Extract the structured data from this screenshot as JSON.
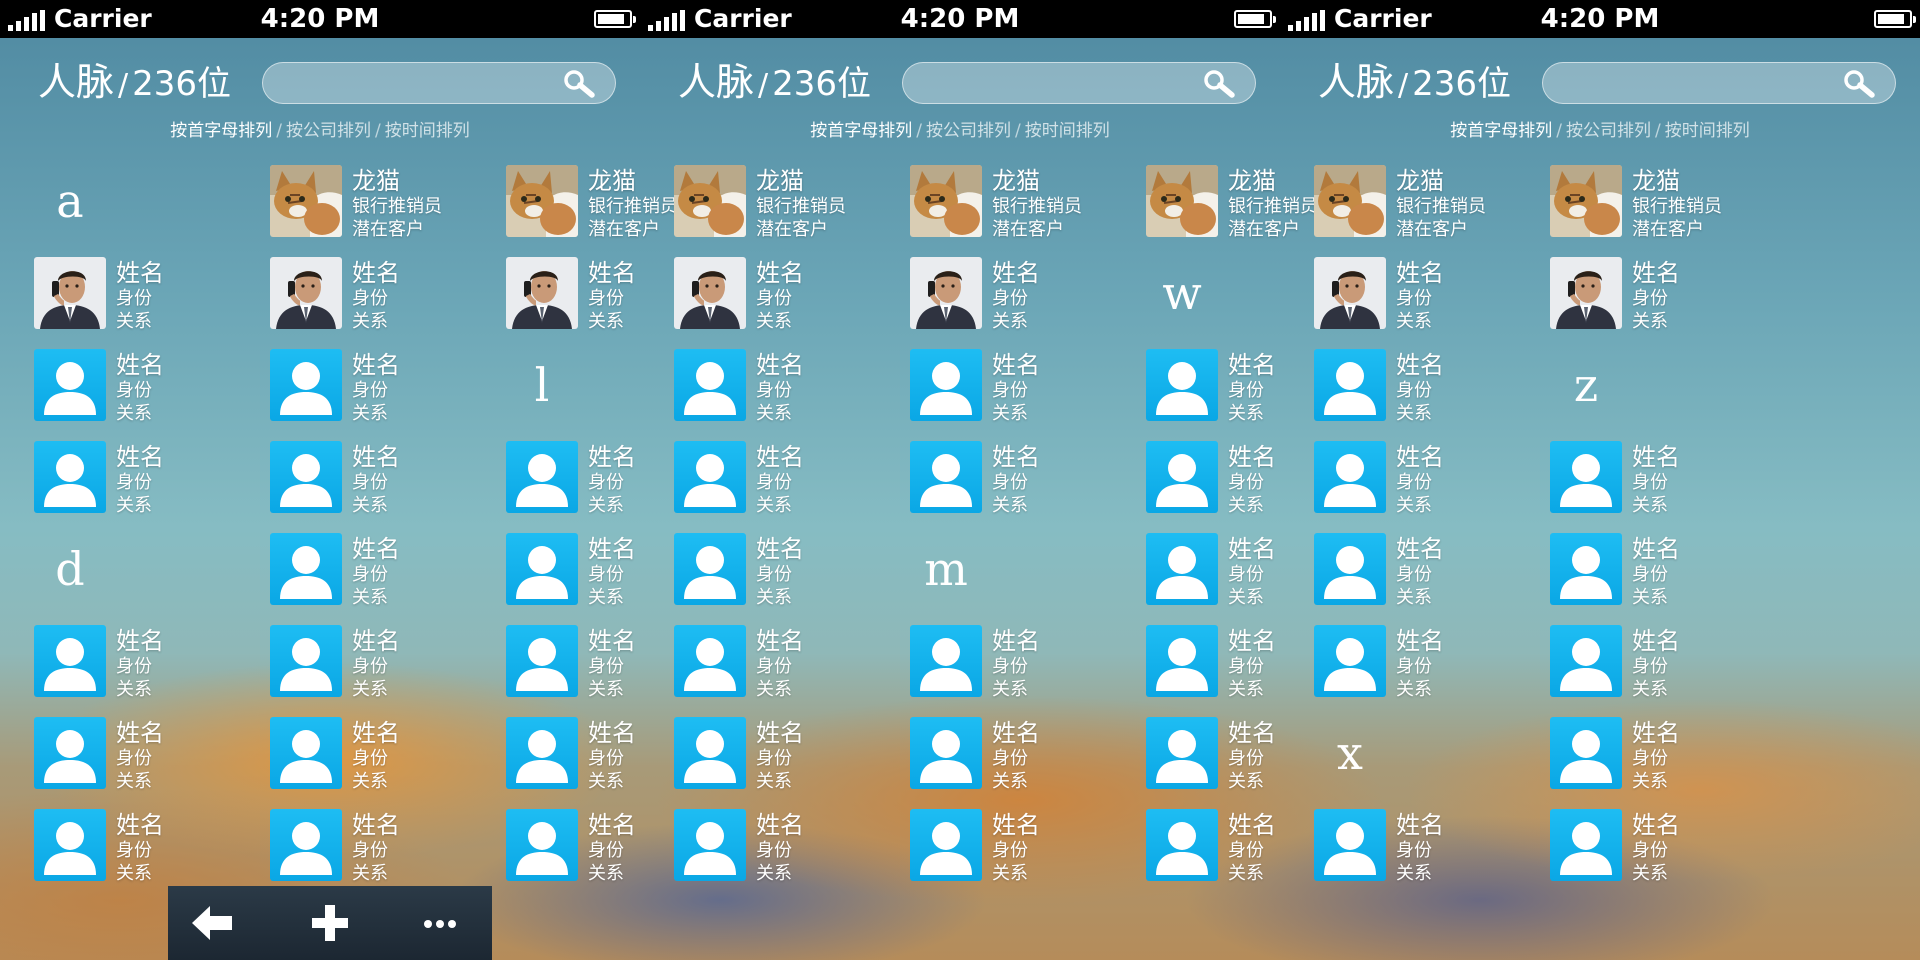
{
  "status": {
    "carrier": "Carrier",
    "time": "4:20 PM",
    "battery_level": 0.85
  },
  "header": {
    "title": "人脉",
    "separator": "/",
    "count": "236位",
    "search": {
      "placeholder": "",
      "value": ""
    }
  },
  "sort_options": [
    {
      "label": "按首字母排列",
      "active": true
    },
    {
      "label": "按公司排列",
      "active": false
    },
    {
      "label": "按时间排列",
      "active": false
    }
  ],
  "contacts": {
    "featured_cat": {
      "name": "龙猫",
      "role": "银行推销员",
      "relation": "潜在客户"
    },
    "featured_man": {
      "name": "姓名",
      "role": "身份",
      "relation": "关系"
    },
    "placeholder": {
      "name": "姓名",
      "role": "身份",
      "relation": "关系"
    }
  },
  "icons": {
    "search": "search-icon",
    "back": "back-arrow-icon",
    "add": "plus-icon",
    "more": "more-icon"
  },
  "colors": {
    "avatar_blue": "#13b3ee",
    "status_bar": "#000000"
  },
  "panels": [
    {
      "grid": [
        [
          "L:a",
          "cat",
          "cat"
        ],
        [
          "man",
          "man",
          "man"
        ],
        [
          "ph",
          "ph",
          "L:l"
        ],
        [
          "ph",
          "ph",
          "ph"
        ],
        [
          "L:d",
          "ph",
          "ph"
        ],
        [
          "ph",
          "ph",
          "ph"
        ],
        [
          "ph",
          "ph",
          "ph"
        ],
        [
          "ph",
          "ph",
          "ph"
        ]
      ],
      "toolbar": true
    },
    {
      "grid": [
        [
          "cat",
          "cat",
          "cat"
        ],
        [
          "man",
          "man",
          "L:w"
        ],
        [
          "ph",
          "ph",
          "ph"
        ],
        [
          "ph",
          "ph",
          "ph"
        ],
        [
          "ph",
          "L:m",
          "ph"
        ],
        [
          "ph",
          "ph",
          "ph"
        ],
        [
          "ph",
          "ph",
          "ph"
        ],
        [
          "ph",
          "ph",
          "ph"
        ]
      ],
      "toolbar": false
    },
    {
      "grid": [
        [
          "cat",
          "cat",
          "-"
        ],
        [
          "man",
          "man",
          "-"
        ],
        [
          "ph",
          "L:z",
          "-"
        ],
        [
          "ph",
          "ph",
          "-"
        ],
        [
          "ph",
          "ph",
          "-"
        ],
        [
          "ph",
          "ph",
          "-"
        ],
        [
          "L:x",
          "ph",
          "-"
        ],
        [
          "ph",
          "ph",
          "-"
        ]
      ],
      "toolbar": false
    }
  ]
}
